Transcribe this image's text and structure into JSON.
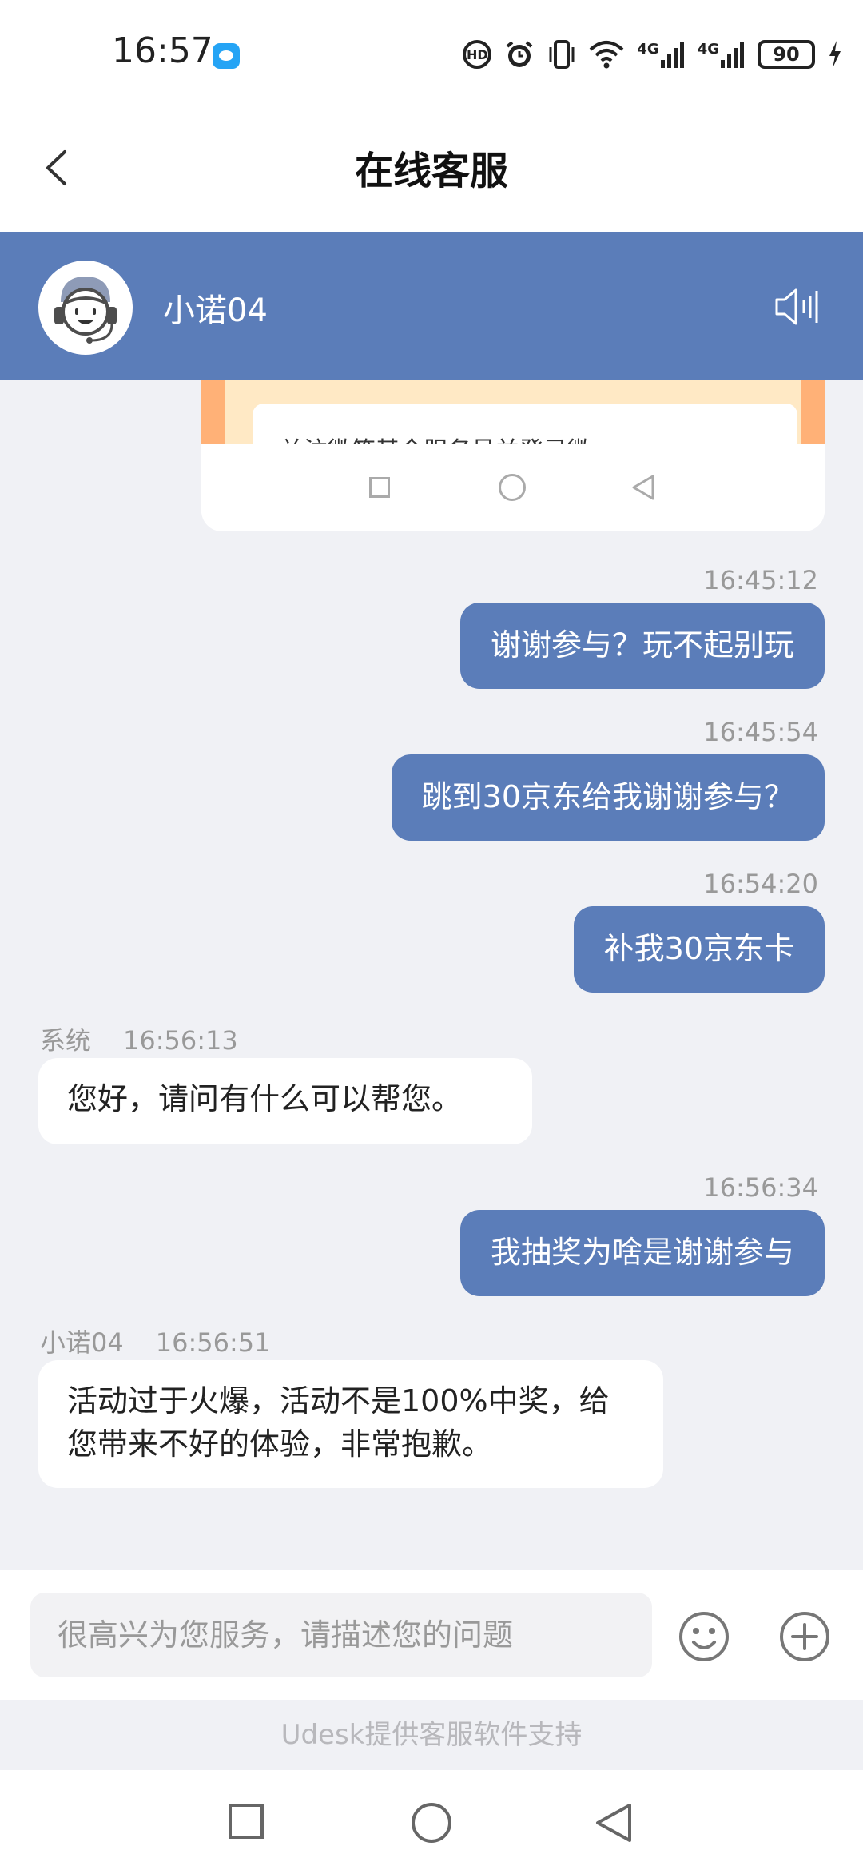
{
  "status_bar": {
    "time": "16:57",
    "hd_label": "HD",
    "signal1_label": "4G",
    "signal2_label": "4G",
    "battery": "90"
  },
  "header": {
    "title": "在线客服"
  },
  "agent": {
    "name": "小诺04"
  },
  "shared_image": {
    "text": "关注微笑基金服务号并登录微"
  },
  "messages": [
    {
      "side": "out",
      "time": "16:45:12",
      "text": "谢谢参与？玩不起别玩"
    },
    {
      "side": "out",
      "time": "16:45:54",
      "text": "跳到30京东给我谢谢参与？"
    },
    {
      "side": "out",
      "time": "16:54:20",
      "text": "补我30京东卡"
    },
    {
      "side": "in",
      "sender": "系统",
      "time": "16:56:13",
      "text": "您好，请问有什么可以帮您。"
    },
    {
      "side": "out",
      "time": "16:56:34",
      "text": "我抽奖为啥是谢谢参与"
    },
    {
      "side": "in",
      "sender": "小诺04",
      "time": "16:56:51",
      "text": "活动过于火爆，活动不是100%中奖，给您带来不好的体验，非常抱歉。"
    }
  ],
  "input": {
    "placeholder": "很高兴为您服务，请描述您的问题"
  },
  "footer": {
    "powered_by": "Udesk提供客服软件支持"
  },
  "colors": {
    "accent": "#5b7db9",
    "background": "#f0f1f5",
    "bubble_in": "#ffffff",
    "timestamp": "#999999"
  }
}
